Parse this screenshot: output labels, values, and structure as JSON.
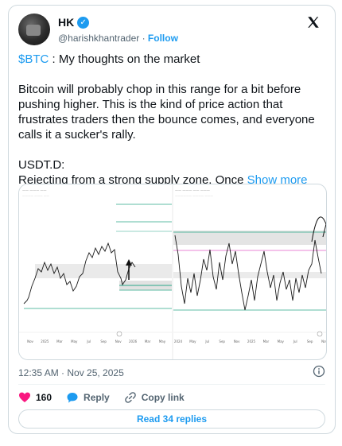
{
  "author": {
    "name": "HK",
    "handle": "@harishkhantrader",
    "separator": "·",
    "follow_label": "Follow"
  },
  "tweet": {
    "cashtag": "$BTC",
    "line1_rest": " :  My thoughts on the market",
    "paragraph2": "Bitcoin will probably chop in this range for a bit before pushing higher. This is the kind of price action that frustrates traders then the bounce comes, and everyone calls it a sucker's rally.",
    "line3": "USDT.D:",
    "line4": "Rejecting from a strong supply zone. Once ",
    "show_more": "Show more"
  },
  "media": {
    "left_chart": {
      "x_ticks": [
        "Nov",
        "2025",
        "Mar",
        "May",
        "Jul",
        "Sep",
        "Nov",
        "2026",
        "Mar",
        "May"
      ]
    },
    "right_chart": {
      "x_ticks": [
        "2024",
        "May",
        "Jul",
        "Sep",
        "Nov",
        "2025",
        "Mar",
        "May",
        "Jul",
        "Sep",
        "Nov"
      ]
    }
  },
  "timestamp": "12:35 AM · Nov 25, 2025",
  "actions": {
    "likes": "160",
    "reply_label": "Reply",
    "copy_link_label": "Copy link"
  },
  "read_replies_label": "Read 34 replies",
  "colors": {
    "link": "#1d9bf0",
    "like": "#f91880",
    "muted": "#536471",
    "zone": "#2aa889"
  }
}
